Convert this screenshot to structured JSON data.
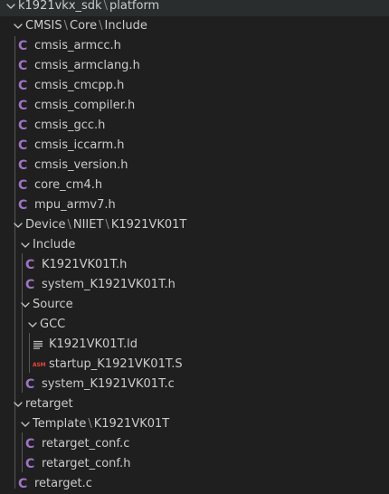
{
  "explorer": {
    "rows": [
      {
        "kind": "folder",
        "depth": 0,
        "parts": [
          "k1921vkx_sdk",
          "platform"
        ]
      },
      {
        "kind": "folder",
        "depth": 1,
        "parts": [
          "CMSIS",
          "Core",
          "Include"
        ]
      },
      {
        "kind": "c",
        "depth": 2,
        "label": "cmsis_armcc.h"
      },
      {
        "kind": "c",
        "depth": 2,
        "label": "cmsis_armclang.h"
      },
      {
        "kind": "c",
        "depth": 2,
        "label": "cmsis_cmcpp.h"
      },
      {
        "kind": "c",
        "depth": 2,
        "label": "cmsis_compiler.h"
      },
      {
        "kind": "c",
        "depth": 2,
        "label": "cmsis_gcc.h"
      },
      {
        "kind": "c",
        "depth": 2,
        "label": "cmsis_iccarm.h"
      },
      {
        "kind": "c",
        "depth": 2,
        "label": "cmsis_version.h"
      },
      {
        "kind": "c",
        "depth": 2,
        "label": "core_cm4.h"
      },
      {
        "kind": "c",
        "depth": 2,
        "label": "mpu_armv7.h"
      },
      {
        "kind": "folder",
        "depth": 1,
        "parts": [
          "Device",
          "NIIET",
          "K1921VK01T"
        ]
      },
      {
        "kind": "folder",
        "depth": 2,
        "parts": [
          "Include"
        ]
      },
      {
        "kind": "c",
        "depth": 3,
        "label": "K1921VK01T.h"
      },
      {
        "kind": "c",
        "depth": 3,
        "label": "system_K1921VK01T.h"
      },
      {
        "kind": "folder",
        "depth": 2,
        "parts": [
          "Source"
        ]
      },
      {
        "kind": "folder",
        "depth": 3,
        "parts": [
          "GCC"
        ]
      },
      {
        "kind": "ld",
        "depth": 4,
        "label": "K1921VK01T.ld"
      },
      {
        "kind": "asm",
        "depth": 4,
        "label": "startup_K1921VK01T.S"
      },
      {
        "kind": "c",
        "depth": 3,
        "label": "system_K1921VK01T.c"
      },
      {
        "kind": "folder",
        "depth": 1,
        "parts": [
          "retarget"
        ]
      },
      {
        "kind": "folder",
        "depth": 2,
        "parts": [
          "Template",
          "K1921VK01T"
        ]
      },
      {
        "kind": "c",
        "depth": 3,
        "label": "retarget_conf.c"
      },
      {
        "kind": "c",
        "depth": 3,
        "label": "retarget_conf.h"
      },
      {
        "kind": "c",
        "depth": 2,
        "label": "retarget.c"
      }
    ],
    "icons": {
      "c_glyph": "C",
      "asm_glyph": "ASM",
      "c_color": "#a074c4",
      "asm_color": "#e8453c"
    },
    "path_separator": "\\"
  }
}
